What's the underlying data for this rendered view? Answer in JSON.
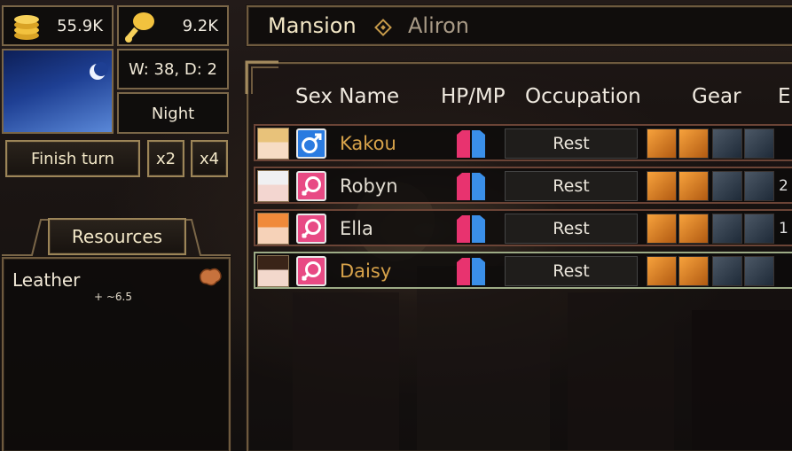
{
  "resources_bar": {
    "gold": "55.9K",
    "food": "9.2K"
  },
  "calendar": {
    "week_day": "W: 38, D: 2",
    "time_of_day": "Night"
  },
  "turn_controls": {
    "finish_turn_label": "Finish turn",
    "speed_x2_label": "x2",
    "speed_x4_label": "x4"
  },
  "resources_panel": {
    "title": "Resources",
    "items": [
      {
        "name": "Leather",
        "rate": "+ ~6.5",
        "icon": "leather-icon"
      }
    ]
  },
  "location": {
    "place": "Mansion",
    "separator_icon": "diamond-icon",
    "region": "Aliron"
  },
  "table": {
    "headers": {
      "sex_name": "Sex Name",
      "hp_mp": "HP/MP",
      "occupation": "Occupation",
      "gear": "Gear",
      "extra": "E"
    },
    "rows": [
      {
        "name": "Kakou",
        "sex": "male",
        "occupation": "Rest",
        "extra": "",
        "name_color": "#d7a24a",
        "selected": false
      },
      {
        "name": "Robyn",
        "sex": "female",
        "occupation": "Rest",
        "extra": "2",
        "name_color": "#e2ddd2",
        "selected": false
      },
      {
        "name": "Ella",
        "sex": "female",
        "occupation": "Rest",
        "extra": "1",
        "name_color": "#e2ddd2",
        "selected": false
      },
      {
        "name": "Daisy",
        "sex": "female",
        "occupation": "Rest",
        "extra": "",
        "name_color": "#d7a24a",
        "selected": true
      }
    ]
  },
  "colors": {
    "gold_text": "#d7a24a",
    "male_icon": "#2a7be0",
    "female_icon": "#e84a84",
    "hp_bar": "#e8336f",
    "mp_bar": "#3a8fe8",
    "frame": "#7a6648"
  }
}
